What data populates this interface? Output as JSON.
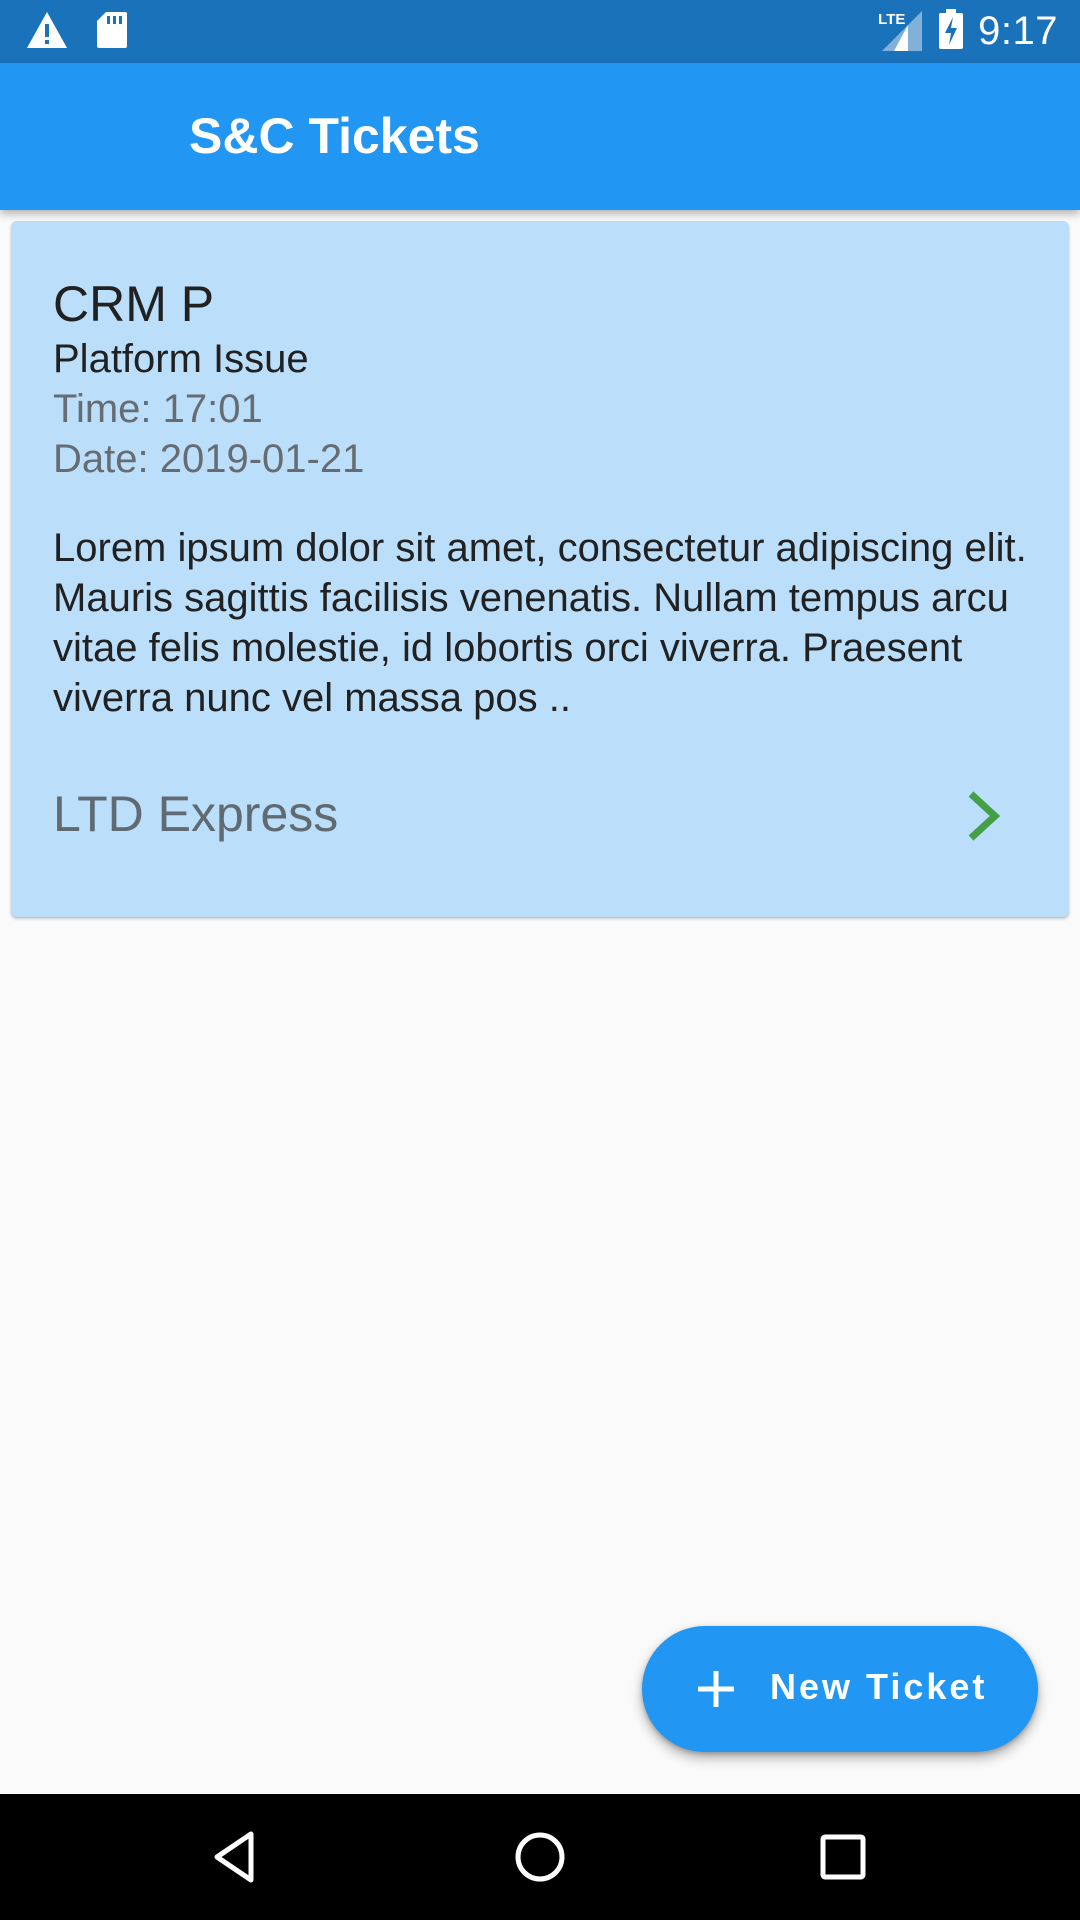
{
  "status_bar": {
    "time": "9:17",
    "network_label": "LTE",
    "icons": [
      "warning-icon",
      "sd-card-icon",
      "lte-signal-icon",
      "battery-charging-icon"
    ]
  },
  "app_bar": {
    "title": "S&C Tickets",
    "color": "#2196f3"
  },
  "tickets": [
    {
      "title": "CRM P",
      "category": "Platform Issue",
      "time": "Time: 17:01",
      "date": "Date: 2019-01-21",
      "description": "Lorem ipsum dolor sit amet, consectetur adipiscing elit. Mauris sagittis facilisis venenatis. Nullam tempus arcu vitae felis molestie, id lobortis orci viverra. Praesent viverra nunc vel massa pos ..",
      "company": "LTD Express",
      "card_color": "#bbdefb",
      "chevron_color": "#43a047"
    }
  ],
  "fab": {
    "label": "New Ticket",
    "icon": "plus-icon"
  },
  "nav_bar": {
    "buttons": [
      "back-icon",
      "home-icon",
      "recents-icon"
    ]
  }
}
